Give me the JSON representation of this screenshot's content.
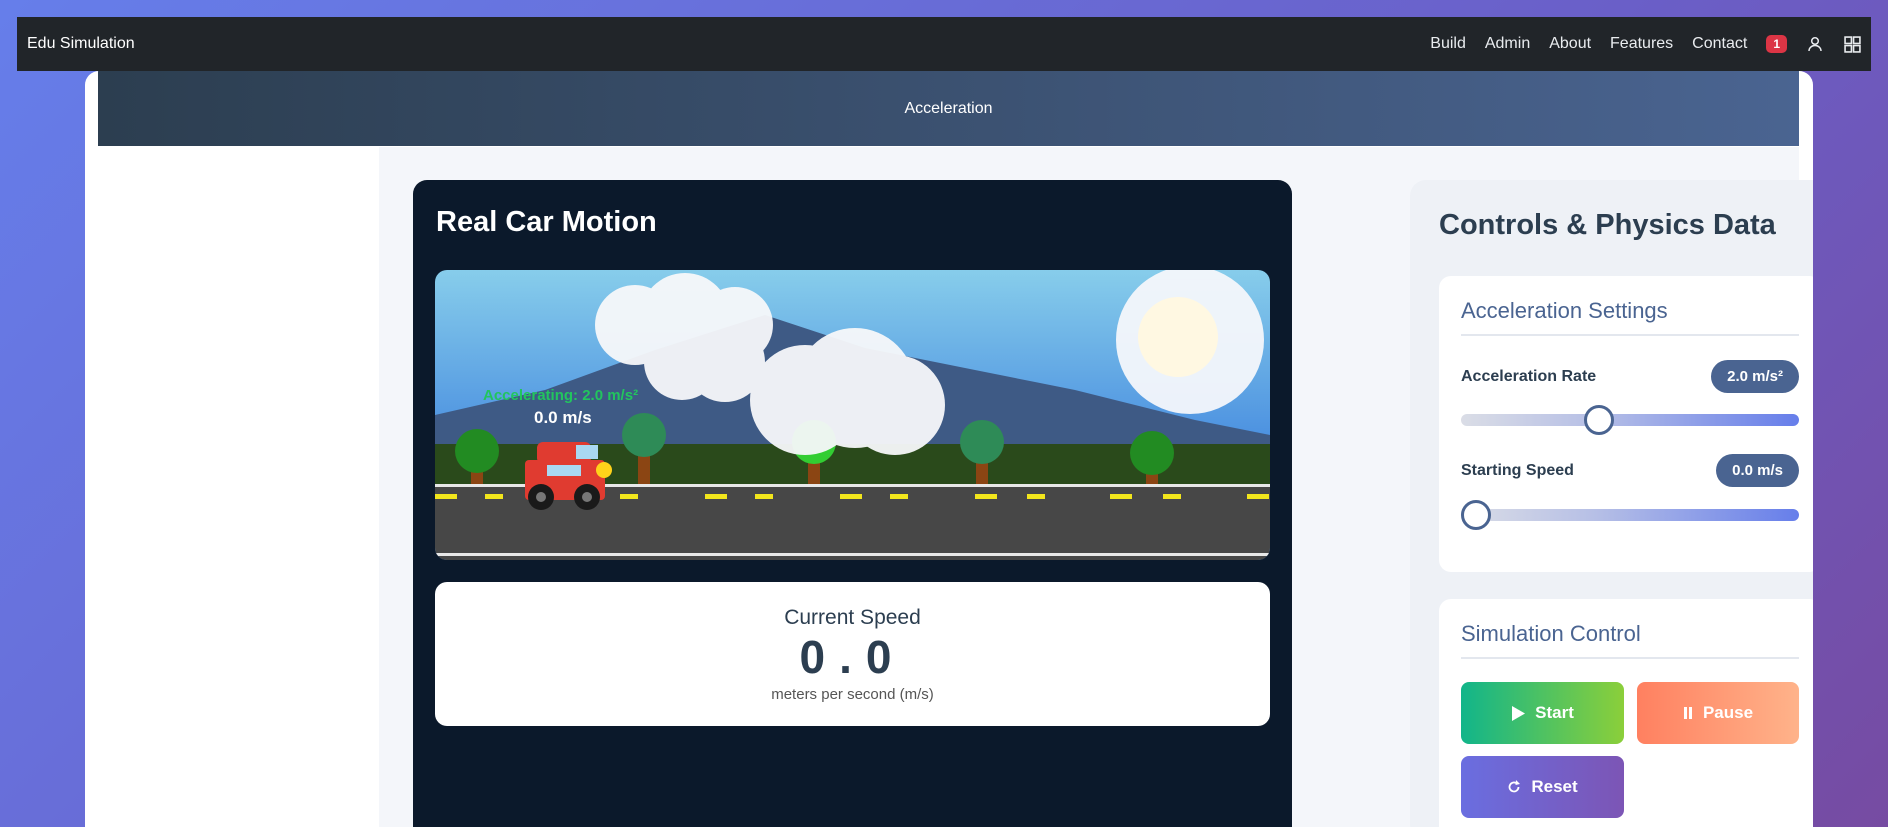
{
  "navbar": {
    "brand": "Edu Simulation",
    "links": [
      "Build",
      "Admin",
      "About",
      "Features",
      "Contact"
    ],
    "notification_count": "1",
    "icons": [
      "user-icon",
      "grid-icon"
    ]
  },
  "header": {
    "title": "Acceleration"
  },
  "simulation": {
    "title": "Real Car Motion",
    "overlay_accel": "Accelerating: 2.0 m/s²",
    "overlay_speed": "0.0 m/s",
    "speed_label": "Current Speed",
    "speed_value": "0.0",
    "speed_unit": "meters per second (m/s)"
  },
  "controls": {
    "title": "Controls & Physics Data",
    "settings_title": "Acceleration Settings",
    "accel_label": "Acceleration Rate",
    "accel_value": "2.0 m/s²",
    "accel_fraction": 0.4,
    "start_speed_label": "Starting Speed",
    "start_speed_value": "0.0 m/s",
    "start_speed_fraction": 0.0,
    "sim_control_title": "Simulation Control",
    "start_label": "Start",
    "pause_label": "Pause",
    "reset_label": "Reset"
  },
  "colors": {
    "navbar": "#212529",
    "header_start": "#2c3e50",
    "header_end": "#4a6491",
    "sim_panel": "#0b192b",
    "accent": "#4a6491",
    "overlay_accel_text": "#22c55e"
  }
}
